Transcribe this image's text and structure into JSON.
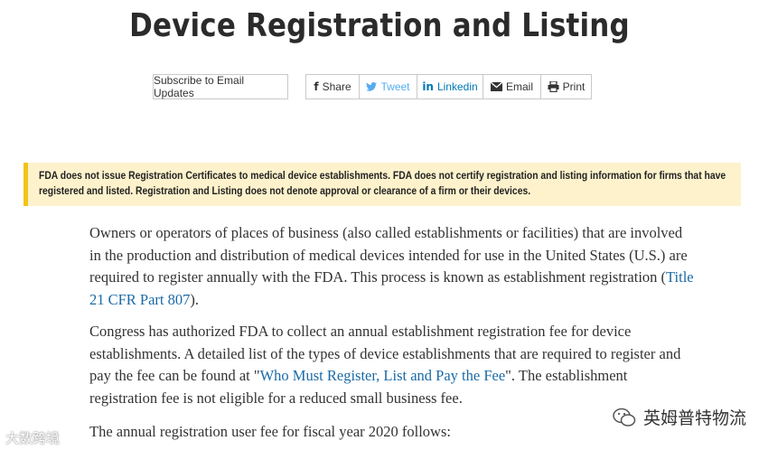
{
  "page": {
    "title": "Device Registration and Listing"
  },
  "toolbar": {
    "subscribe_label": "Subscribe to Email Updates",
    "share_label": "Share",
    "tweet_label": "Tweet",
    "linkedin_label": "Linkedin",
    "email_label": "Email",
    "print_label": "Print"
  },
  "alert": {
    "text": "FDA does not issue Registration Certificates to medical device establishments. FDA does not certify registration and listing information for firms that have registered and listed. Registration and Listing does not denote approval or clearance of a firm or their devices."
  },
  "content": {
    "p1_text": "Owners or operators of places of business (also called establishments or facilities) that are involved in the production and distribution of medical devices intended for use in the United States (U.S.) are required to register annually with the FDA. This process is known as establishment registration (",
    "p1_link": "Title 21 CFR Part 807",
    "p1_end": ").",
    "p2_text": "Congress has authorized FDA to collect an annual establishment registration fee for device establishments. A detailed list of the types of device establishments that are required to register and pay the fee can be found at \"",
    "p2_link": "Who Must Register, List and Pay the Fee",
    "p2_end": "\". The establishment registration fee is not eligible for a reduced small business fee.",
    "p3_text": "The annual registration user fee for fiscal year 2020 follows:"
  },
  "watermarks": {
    "left": "大数跨境",
    "right": "英姆普特物流"
  },
  "colors": {
    "alert_bg": "#fdf2cc",
    "alert_border": "#f2c418",
    "link": "#1a6aa6",
    "twitter": "#55acee",
    "linkedin": "#0077b5"
  }
}
